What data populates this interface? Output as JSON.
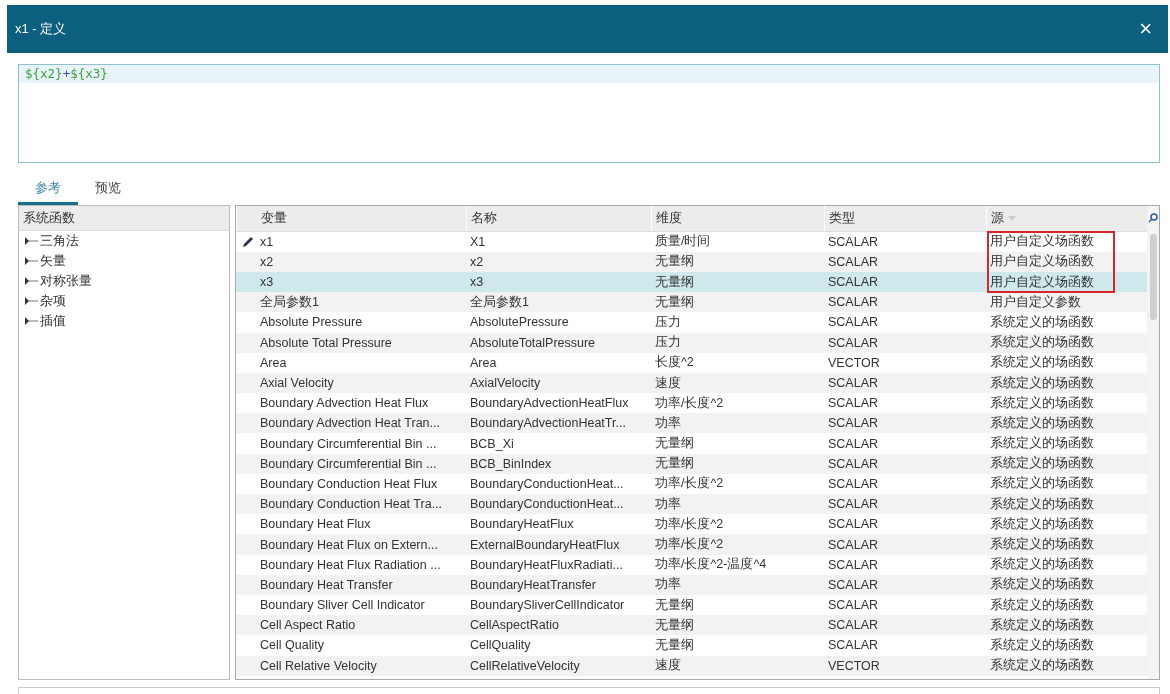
{
  "window": {
    "title": "x1 - 定义",
    "close": "×"
  },
  "formula": [
    {
      "text": "${x2}",
      "kind": "ref"
    },
    {
      "text": "+",
      "kind": "op"
    },
    {
      "text": "${x3}",
      "kind": "ref"
    }
  ],
  "tabs": [
    {
      "label": "参考",
      "selected": true
    },
    {
      "label": "预览",
      "selected": false
    }
  ],
  "tree": {
    "title": "系统函数",
    "items": [
      {
        "label": "三角法",
        "expanded": false
      },
      {
        "label": "矢量",
        "expanded": false
      },
      {
        "label": "对称张量",
        "expanded": false
      },
      {
        "label": "杂项",
        "expanded": false
      },
      {
        "label": "插值",
        "expanded": false
      }
    ]
  },
  "table": {
    "columns": [
      "变量",
      "名称",
      "维度",
      "类型",
      "源"
    ],
    "rows": [
      {
        "cells": [
          "x1",
          "X1",
          "质量/时间",
          "SCALAR",
          "用户自定义场函数"
        ],
        "editing": true,
        "selected": false,
        "marked": true
      },
      {
        "cells": [
          "x2",
          "x2",
          "无量纲",
          "SCALAR",
          "用户自定义场函数"
        ],
        "editing": false,
        "selected": false,
        "marked": true
      },
      {
        "cells": [
          "x3",
          "x3",
          "无量纲",
          "SCALAR",
          "用户自定义场函数"
        ],
        "editing": false,
        "selected": true,
        "marked": true
      },
      {
        "cells": [
          "全局参数1",
          "全局参数1",
          "无量纲",
          "SCALAR",
          "用户自定义参数"
        ],
        "editing": false,
        "selected": false,
        "marked": false
      },
      {
        "cells": [
          "Absolute Pressure",
          "AbsolutePressure",
          "压力",
          "SCALAR",
          "系统定义的场函数"
        ],
        "editing": false,
        "selected": false,
        "marked": false
      },
      {
        "cells": [
          "Absolute Total Pressure",
          "AbsoluteTotalPressure",
          "压力",
          "SCALAR",
          "系统定义的场函数"
        ],
        "editing": false,
        "selected": false,
        "marked": false
      },
      {
        "cells": [
          "Area",
          "Area",
          "长度^2",
          "VECTOR",
          "系统定义的场函数"
        ],
        "editing": false,
        "selected": false,
        "marked": false
      },
      {
        "cells": [
          "Axial Velocity",
          "AxialVelocity",
          "速度",
          "SCALAR",
          "系统定义的场函数"
        ],
        "editing": false,
        "selected": false,
        "marked": false
      },
      {
        "cells": [
          "Boundary Advection Heat Flux",
          "BoundaryAdvectionHeatFlux",
          "功率/长度^2",
          "SCALAR",
          "系统定义的场函数"
        ],
        "editing": false,
        "selected": false,
        "marked": false
      },
      {
        "cells": [
          "Boundary Advection Heat Tran...",
          "BoundaryAdvectionHeatTr...",
          "功率",
          "SCALAR",
          "系统定义的场函数"
        ],
        "editing": false,
        "selected": false,
        "marked": false
      },
      {
        "cells": [
          "Boundary Circumferential Bin ...",
          "BCB_Xi",
          "无量纲",
          "SCALAR",
          "系统定义的场函数"
        ],
        "editing": false,
        "selected": false,
        "marked": false
      },
      {
        "cells": [
          "Boundary Circumferential Bin ...",
          "BCB_BinIndex",
          "无量纲",
          "SCALAR",
          "系统定义的场函数"
        ],
        "editing": false,
        "selected": false,
        "marked": false
      },
      {
        "cells": [
          "Boundary Conduction Heat Flux",
          "BoundaryConductionHeat...",
          "功率/长度^2",
          "SCALAR",
          "系统定义的场函数"
        ],
        "editing": false,
        "selected": false,
        "marked": false
      },
      {
        "cells": [
          "Boundary Conduction Heat Tra...",
          "BoundaryConductionHeat...",
          "功率",
          "SCALAR",
          "系统定义的场函数"
        ],
        "editing": false,
        "selected": false,
        "marked": false
      },
      {
        "cells": [
          "Boundary Heat Flux",
          "BoundaryHeatFlux",
          "功率/长度^2",
          "SCALAR",
          "系统定义的场函数"
        ],
        "editing": false,
        "selected": false,
        "marked": false
      },
      {
        "cells": [
          "Boundary Heat Flux on Extern...",
          "ExternalBoundaryHeatFlux",
          "功率/长度^2",
          "SCALAR",
          "系统定义的场函数"
        ],
        "editing": false,
        "selected": false,
        "marked": false
      },
      {
        "cells": [
          "Boundary Heat Flux Radiation ...",
          "BoundaryHeatFluxRadiati...",
          "功率/长度^2-温度^4",
          "SCALAR",
          "系统定义的场函数"
        ],
        "editing": false,
        "selected": false,
        "marked": false
      },
      {
        "cells": [
          "Boundary Heat Transfer",
          "BoundaryHeatTransfer",
          "功率",
          "SCALAR",
          "系统定义的场函数"
        ],
        "editing": false,
        "selected": false,
        "marked": false
      },
      {
        "cells": [
          "Boundary Sliver Cell Indicator",
          "BoundarySliverCellIndicator",
          "无量纲",
          "SCALAR",
          "系统定义的场函数"
        ],
        "editing": false,
        "selected": false,
        "marked": false
      },
      {
        "cells": [
          "Cell Aspect Ratio",
          "CellAspectRatio",
          "无量纲",
          "SCALAR",
          "系统定义的场函数"
        ],
        "editing": false,
        "selected": false,
        "marked": false
      },
      {
        "cells": [
          "Cell Quality",
          "CellQuality",
          "无量纲",
          "SCALAR",
          "系统定义的场函数"
        ],
        "editing": false,
        "selected": false,
        "marked": false
      },
      {
        "cells": [
          "Cell Relative Velocity",
          "CellRelativeVelocity",
          "速度",
          "VECTOR",
          "系统定义的场函数"
        ],
        "editing": false,
        "selected": false,
        "marked": false
      }
    ]
  }
}
